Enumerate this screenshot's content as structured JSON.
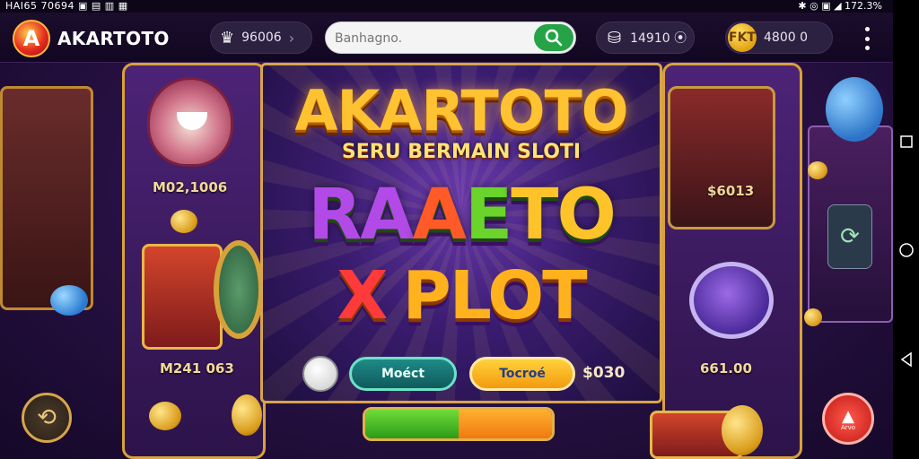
{
  "statusbar": {
    "left": "HAI65 70694 ▣ ▤ ▥ ▦",
    "right": "✱ ◎ ▣ ◢ 172.3%"
  },
  "header": {
    "logo_text": "AKARTOTO",
    "logo_letter": "A",
    "star_pill": {
      "value": "96006",
      "icon": "crown-icon"
    },
    "search": {
      "placeholder": "Banhagno."
    },
    "coins_pill": {
      "value": "14910 ⦿",
      "icon": "coins-icon"
    },
    "gold_pill": {
      "value": "4800 0",
      "icon_text": "FKT"
    }
  },
  "background": {
    "left_value_top": "M02,1006",
    "left_value_bottom": "M241 063",
    "right_value_top": "$6013",
    "right_value_bottom": "661.00"
  },
  "modal": {
    "title": "AKARTOTO",
    "subtitle": "SERU BERMAIN SLOTI",
    "big_line1": [
      "RA",
      "A",
      "E",
      "TO"
    ],
    "big_line2_prefix": "X",
    "big_line2": "PLOT",
    "teal_button": "Moéct",
    "orange_button": "Tocroé",
    "amount": "$030"
  },
  "progress": {
    "green_fraction": 0.5,
    "total_fraction": 1.0
  },
  "fab_right": {
    "label": "Arvo"
  },
  "colors": {
    "accent_gold": "#d9a44a",
    "green": "#25a346",
    "brand_red": "#e52d1f"
  }
}
